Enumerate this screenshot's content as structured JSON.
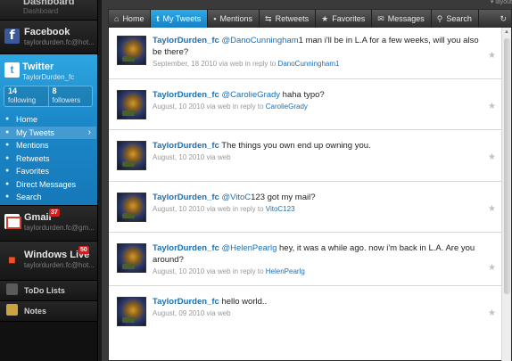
{
  "sidebar": {
    "dashboard": {
      "name": "Dashboard",
      "sub": "Dashboard"
    },
    "facebook": {
      "name": "Facebook",
      "sub": "taylordurden.fc@hot..."
    },
    "twitter": {
      "name": "Twitter",
      "sub": "TaylorDurden_fc",
      "following_count": "14",
      "following_label": "following",
      "followers_count": "8",
      "followers_label": "followers",
      "nav": [
        {
          "label": "Home",
          "icon": "home-icon"
        },
        {
          "label": "My Tweets",
          "icon": "bird-icon",
          "active": true
        },
        {
          "label": "Mentions",
          "icon": "chat-icon"
        },
        {
          "label": "Retweets",
          "icon": "retweet-icon"
        },
        {
          "label": "Favorites",
          "icon": "star-icon"
        },
        {
          "label": "Direct Messages",
          "icon": "envelope-icon"
        },
        {
          "label": "Search",
          "icon": "search-icon"
        }
      ]
    },
    "gmail": {
      "name": "Gmail",
      "sub": "taylordurden.fc@gm...",
      "badge": "37"
    },
    "windows_live": {
      "name": "Windows Live",
      "sub": "taylordurden.fc@hot...",
      "badge": "50"
    },
    "todo": {
      "name": "ToDo Lists"
    },
    "notes": {
      "name": "Notes"
    }
  },
  "layout_label": "layout",
  "tabs": [
    {
      "label": "Home",
      "icon": "home-icon"
    },
    {
      "label": "My Tweets",
      "icon": "bird-icon",
      "active": true
    },
    {
      "label": "Mentions",
      "icon": "chat-icon"
    },
    {
      "label": "Retweets",
      "icon": "retweet-icon"
    },
    {
      "label": "Favorites",
      "icon": "star-icon"
    },
    {
      "label": "Messages",
      "icon": "envelope-icon"
    },
    {
      "label": "Search",
      "icon": "search-icon"
    }
  ],
  "tweets": [
    {
      "user": "TaylorDurden_fc",
      "mention": "@DanoCunningham",
      "text": "1 man i'll be in L.A for a few weeks, will you also be there?",
      "date": "September, 18 2010 via web in reply to",
      "reply_to": "DanoCunningham1"
    },
    {
      "user": "TaylorDurden_fc",
      "mention": "@CarolieGrady",
      "text": " haha typo?",
      "date": "August, 10 2010 via web in reply to",
      "reply_to": "CarolieGrady"
    },
    {
      "user": "TaylorDurden_fc",
      "mention": "",
      "text": "The things you own end up owning you.",
      "date": "August, 10 2010 via web",
      "reply_to": ""
    },
    {
      "user": "TaylorDurden_fc",
      "mention": "@VitoC",
      "text": "123 got my mail?",
      "date": "August, 10 2010 via web in reply to",
      "reply_to": "VitoC123"
    },
    {
      "user": "TaylorDurden_fc",
      "mention": "@HelenPearlg",
      "text": " hey, it was a while ago. now i'm back in L.A. Are you around?",
      "date": "August, 10 2010 via web in reply to",
      "reply_to": "HelenPearlg"
    },
    {
      "user": "TaylorDurden_fc",
      "mention": "",
      "text": "hello world..",
      "date": "August, 09 2010 via web",
      "reply_to": ""
    }
  ]
}
